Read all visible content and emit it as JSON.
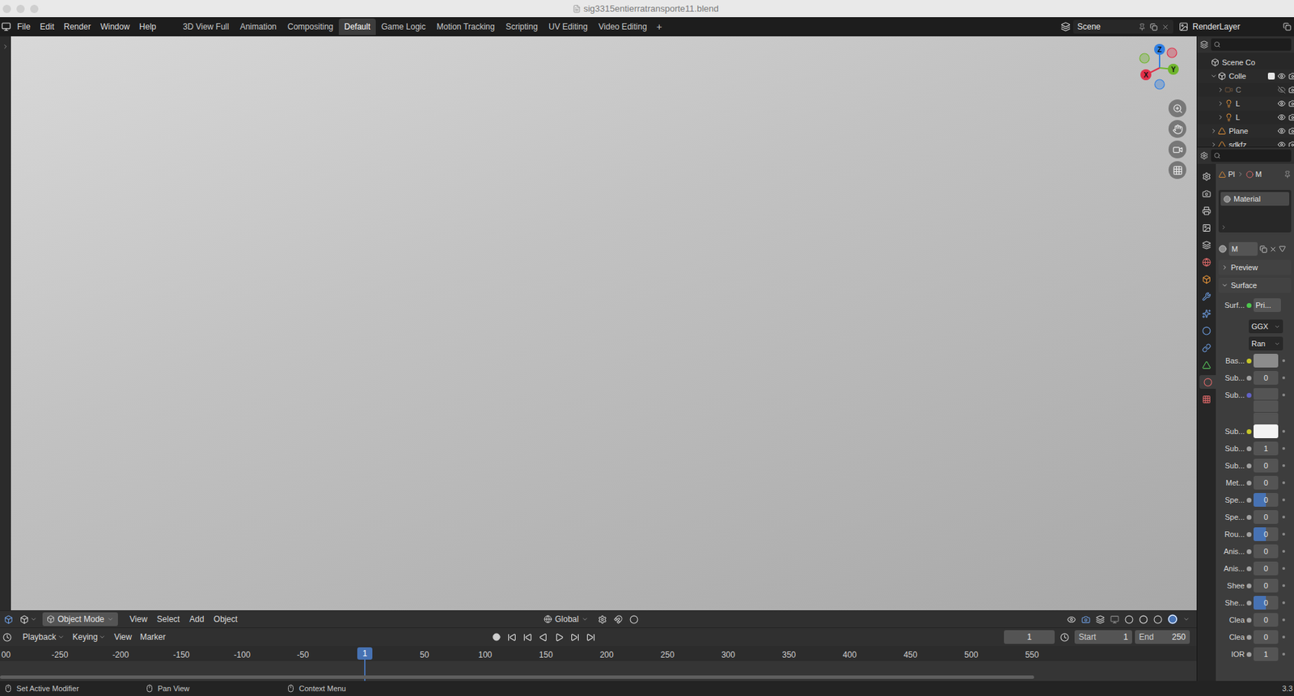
{
  "window": {
    "title": "sig3315entierratransporte11.blend"
  },
  "menu": [
    "File",
    "Edit",
    "Render",
    "Window",
    "Help"
  ],
  "workspaces": [
    {
      "label": "3D View Full",
      "selected": false
    },
    {
      "label": "Animation",
      "selected": false
    },
    {
      "label": "Compositing",
      "selected": false
    },
    {
      "label": "Default",
      "selected": true
    },
    {
      "label": "Game Logic",
      "selected": false
    },
    {
      "label": "Motion Tracking",
      "selected": false
    },
    {
      "label": "Scripting",
      "selected": false
    },
    {
      "label": "UV Editing",
      "selected": false
    },
    {
      "label": "Video Editing",
      "selected": false
    }
  ],
  "add_workspace": "+",
  "scene": {
    "name": "Scene"
  },
  "view_layer": {
    "name": "RenderLayer"
  },
  "viewport": {
    "gizmo": [
      {
        "label": "Z",
        "color": "#2f7fe3"
      },
      {
        "label": "Y",
        "color": "#6fb52c"
      },
      {
        "label": "X",
        "color": "#e0304a"
      }
    ]
  },
  "viewport_header": {
    "mode": "Object Mode",
    "menus": [
      "View",
      "Select",
      "Add",
      "Object"
    ],
    "orientation": "Global"
  },
  "timeline": {
    "menus": [
      "Playback",
      "Keying",
      "View",
      "Marker"
    ],
    "current_frame": "1",
    "start_label": "Start",
    "start": "1",
    "end_label": "End",
    "end": "250",
    "ruler": [
      {
        "label": "00",
        "frame": -300
      },
      {
        "label": "-250",
        "frame": -250
      },
      {
        "label": "-200",
        "frame": -200
      },
      {
        "label": "-150",
        "frame": -150
      },
      {
        "label": "-100",
        "frame": -100
      },
      {
        "label": "-50",
        "frame": -50
      },
      {
        "label": "50",
        "frame": 50
      },
      {
        "label": "100",
        "frame": 100
      },
      {
        "label": "150",
        "frame": 150
      },
      {
        "label": "200",
        "frame": 200
      },
      {
        "label": "250",
        "frame": 250
      },
      {
        "label": "300",
        "frame": 300
      },
      {
        "label": "350",
        "frame": 350
      },
      {
        "label": "400",
        "frame": 400
      },
      {
        "label": "450",
        "frame": 450
      },
      {
        "label": "500",
        "frame": 500
      },
      {
        "label": "550",
        "frame": 550
      }
    ]
  },
  "outliner": {
    "items": [
      {
        "label": "Scene Co",
        "kind": "scene",
        "depth": 0,
        "expanded": true,
        "visible": true,
        "checked": false
      },
      {
        "label": "Colle",
        "kind": "collection",
        "depth": 1,
        "expanded": true,
        "visible": true,
        "checked": true
      },
      {
        "label": "C",
        "kind": "camera",
        "depth": 2,
        "expanded": false,
        "visible": false,
        "checked": false
      },
      {
        "label": "L",
        "kind": "light",
        "depth": 2,
        "expanded": false,
        "visible": true,
        "checked": false
      },
      {
        "label": "L",
        "kind": "light",
        "depth": 2,
        "expanded": false,
        "visible": true,
        "checked": false
      },
      {
        "label": "Plane",
        "kind": "mesh",
        "depth": 1,
        "expanded": false,
        "visible": true,
        "checked": false
      },
      {
        "label": "sdkfz",
        "kind": "mesh",
        "depth": 1,
        "expanded": false,
        "visible": true,
        "checked": false
      }
    ]
  },
  "properties": {
    "tabs": [
      {
        "kind": "tool",
        "selected": false
      },
      {
        "kind": "render",
        "selected": false
      },
      {
        "kind": "output",
        "selected": false
      },
      {
        "kind": "view_layer",
        "selected": false
      },
      {
        "kind": "scene",
        "selected": false
      },
      {
        "kind": "world",
        "selected": false
      },
      {
        "kind": "object",
        "selected": false
      },
      {
        "kind": "modifiers",
        "selected": false
      },
      {
        "kind": "particles",
        "selected": false
      },
      {
        "kind": "physics",
        "selected": false
      },
      {
        "kind": "constraints",
        "selected": false
      },
      {
        "kind": "data",
        "selected": false
      },
      {
        "kind": "material",
        "selected": true
      },
      {
        "kind": "texture",
        "selected": false
      }
    ],
    "breadcrumb": [
      "Pl",
      "M"
    ],
    "slots": [
      {
        "label": "Material",
        "selected": true
      }
    ],
    "material": "M",
    "panels": [
      {
        "label": "Preview",
        "expanded": false
      },
      {
        "label": "Surface",
        "expanded": true
      }
    ],
    "surface": {
      "label": "Surf...",
      "value": "Pri..."
    },
    "distribution": "GGX",
    "subsurface_method": "Ran",
    "inputs": [
      {
        "label": "Bas...",
        "kind": "color",
        "socket": "#c7c729",
        "color": "#8c8c8c"
      },
      {
        "label": "Sub...",
        "kind": "value",
        "socket": "#a1a1a1",
        "value": "0",
        "level": 0
      },
      {
        "label": "Sub...",
        "kind": "vector",
        "socket": "#6363c7",
        "values": [
          "",
          "",
          ""
        ]
      },
      {
        "label": "Sub...",
        "kind": "color",
        "socket": "#c7c729",
        "color": "#f2f2f2"
      },
      {
        "label": "Sub...",
        "kind": "value",
        "socket": "#a1a1a1",
        "value": "1",
        "level": 0
      },
      {
        "label": "Sub...",
        "kind": "value",
        "socket": "#a1a1a1",
        "value": "0",
        "level": 0
      },
      {
        "label": "Met...",
        "kind": "value",
        "socket": "#a1a1a1",
        "value": "0",
        "level": 0
      },
      {
        "label": "Spe...",
        "kind": "value",
        "socket": "#a1a1a1",
        "value": "0",
        "level": 0.5
      },
      {
        "label": "Spe...",
        "kind": "value",
        "socket": "#a1a1a1",
        "value": "0",
        "level": 0
      },
      {
        "label": "Rou...",
        "kind": "value",
        "socket": "#a1a1a1",
        "value": "0",
        "level": 0.5
      },
      {
        "label": "Anis...",
        "kind": "value",
        "socket": "#a1a1a1",
        "value": "0",
        "level": 0
      },
      {
        "label": "Anis...",
        "kind": "value",
        "socket": "#a1a1a1",
        "value": "0",
        "level": 0
      },
      {
        "label": "Shee",
        "kind": "value",
        "socket": "#a1a1a1",
        "value": "0",
        "level": 0
      },
      {
        "label": "She...",
        "kind": "value",
        "socket": "#a1a1a1",
        "value": "0",
        "level": 0.5
      },
      {
        "label": "Clea",
        "kind": "value",
        "socket": "#a1a1a1",
        "value": "0",
        "level": 0
      },
      {
        "label": "Clea",
        "kind": "value",
        "socket": "#a1a1a1",
        "value": "0",
        "level": 0
      },
      {
        "label": "IOR",
        "kind": "value",
        "socket": "#a1a1a1",
        "value": "1",
        "level": 0
      }
    ]
  },
  "status_bar": {
    "items": [
      "Set Active Modifier",
      "Pan View",
      "Context Menu"
    ],
    "version": "3.3"
  }
}
